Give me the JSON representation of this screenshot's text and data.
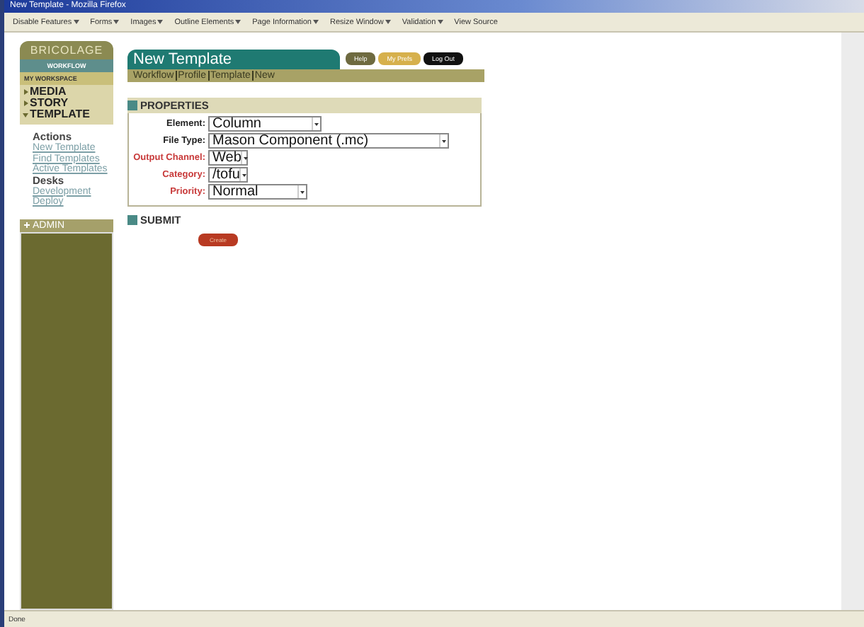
{
  "window": {
    "title": "New Template - Mozilla Firefox"
  },
  "toolbar": [
    {
      "label": "Disable Features",
      "dropdown": true
    },
    {
      "label": "Forms",
      "dropdown": true
    },
    {
      "label": "Images",
      "dropdown": true
    },
    {
      "label": "Outline Elements",
      "dropdown": true
    },
    {
      "label": "Page Information",
      "dropdown": true
    },
    {
      "label": "Resize Window",
      "dropdown": true
    },
    {
      "label": "Validation",
      "dropdown": true
    },
    {
      "label": "View Source",
      "dropdown": false
    }
  ],
  "sidebar": {
    "logo": "BRICOLAGE",
    "tab": "WORKFLOW",
    "workspace": "MY WORKSPACE",
    "nav": [
      {
        "label": "MEDIA",
        "expanded": false
      },
      {
        "label": "STORY",
        "expanded": false
      },
      {
        "label": "TEMPLATE",
        "expanded": true
      }
    ],
    "sections": [
      {
        "heading": "Actions",
        "links": [
          "New Template",
          "Find Templates",
          "Active Templates"
        ]
      },
      {
        "heading": "Desks",
        "links": [
          "Development",
          "Deploy"
        ]
      }
    ],
    "admin": {
      "label": "ADMIN",
      "expanded": false
    }
  },
  "page": {
    "title": "New Template",
    "buttons": [
      {
        "label": "Help",
        "kind": "help"
      },
      {
        "label": "My Prefs",
        "kind": "prefs"
      },
      {
        "label": "Log Out",
        "kind": "logout"
      }
    ],
    "breadcrumb": [
      "Workflow",
      "Profile",
      "Template",
      "New"
    ],
    "properties": {
      "heading": "PROPERTIES",
      "fields": [
        {
          "label": "Element:",
          "value": "Column",
          "required": false
        },
        {
          "label": "File Type:",
          "value": "Mason Component (.mc)",
          "required": false
        },
        {
          "label": "Output Channel:",
          "value": "Web",
          "required": true
        },
        {
          "label": "Category:",
          "value": "/tofu",
          "required": true
        },
        {
          "label": "Priority:",
          "value": "Normal",
          "required": true
        }
      ]
    },
    "submit": {
      "heading": "SUBMIT",
      "button": "Create"
    }
  },
  "status_bar": "Done"
}
